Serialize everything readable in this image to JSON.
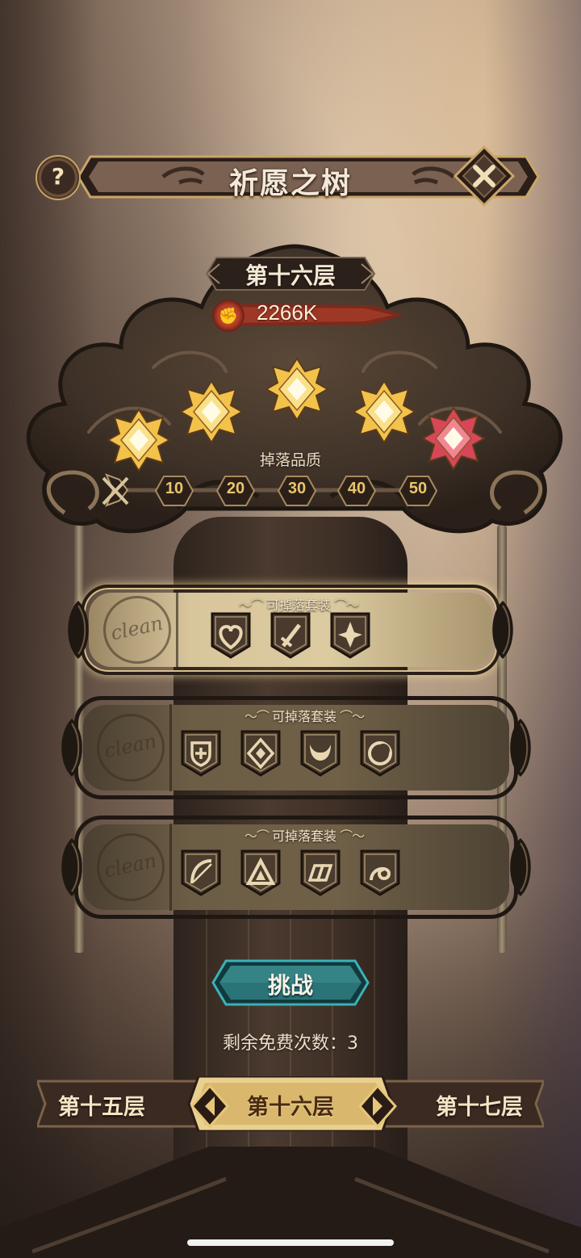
{
  "header": {
    "title": "祈愿之树",
    "help_icon_text": "?",
    "close_icon": "close-x-icon"
  },
  "floor": {
    "title": "第十六层",
    "power_label": "2266K",
    "power_icon": "fist-icon"
  },
  "drop_quality": {
    "label": "掉落品质",
    "levels": [
      "10",
      "20",
      "30",
      "40",
      "50"
    ],
    "gems": [
      "gold",
      "gold",
      "gold",
      "gold",
      "red"
    ],
    "colors": {
      "gold": "#f2c24b",
      "red": "#d8465a"
    }
  },
  "sets": [
    {
      "label": "可掉落套装",
      "label_deco_left": "～⌒",
      "label_deco_right": "⌒～",
      "stamp": "clean",
      "active": true,
      "icons": [
        "heart-icon",
        "sword-icon",
        "star-shuriken-icon"
      ]
    },
    {
      "label": "可掉落套装",
      "label_deco_left": "～⌒",
      "label_deco_right": "⌒～",
      "stamp": "clean",
      "active": false,
      "icons": [
        "shield-plus-icon",
        "diamond-eye-icon",
        "horns-icon",
        "crescent-icon"
      ]
    },
    {
      "label": "可掉落套装",
      "label_deco_left": "～⌒",
      "label_deco_right": "⌒～",
      "stamp": "clean",
      "active": false,
      "icons": [
        "bow-icon",
        "triangle-icon",
        "chain-link-icon",
        "swirl-icon"
      ]
    }
  ],
  "challenge": {
    "label": "挑战",
    "free_count": "剩余免费次数：3"
  },
  "floor_nav": {
    "prev": "第十五层",
    "current": "第十六层",
    "next": "第十七层"
  }
}
